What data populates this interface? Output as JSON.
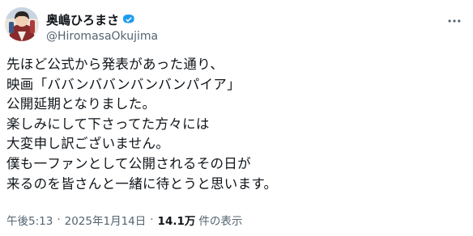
{
  "author": {
    "display_name": "奥嶋ひろまさ",
    "handle": "@HiromasaOkujima",
    "verified": true
  },
  "icons": {
    "avatar": "profile-avatar",
    "verified": "verified-badge-icon",
    "more": "more-options-icon"
  },
  "colors": {
    "text": "#0f1419",
    "secondary": "#536471",
    "verified": "#1d9bf0"
  },
  "post": {
    "lines": [
      "先ほど公式から発表があった通り、",
      "映画「ババンババンバンバンパイア」",
      "公開延期となりました。",
      "楽しみにして下さってた方々には",
      "大変申し訳ございません。",
      "僕も一ファンとして公開されるその日が",
      "来るのを皆さんと一緒に待とうと思います。"
    ]
  },
  "meta": {
    "time": "午後5:13",
    "date": "2025年1月14日",
    "separator": "·",
    "views_count": "14.1万",
    "views_label": "件の表示"
  }
}
